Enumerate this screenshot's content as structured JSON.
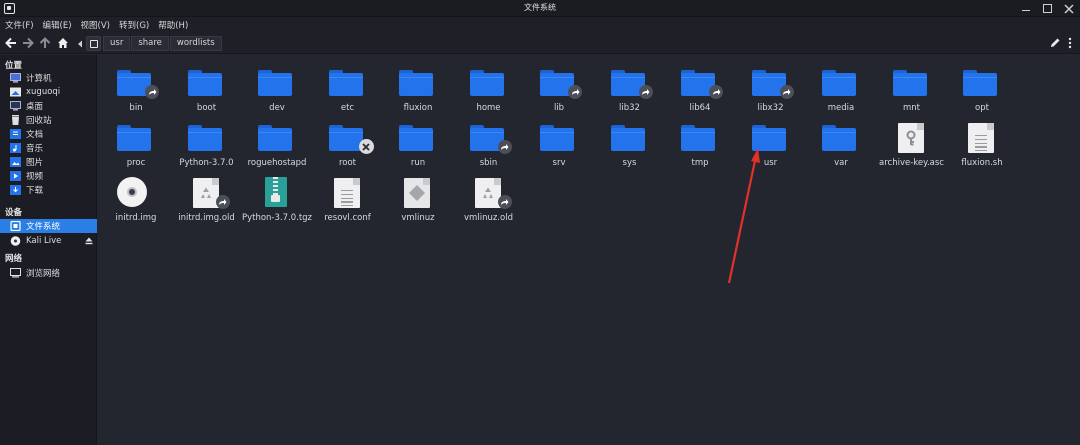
{
  "window": {
    "title": "文件系统"
  },
  "menu": [
    "文件(F)",
    "编辑(E)",
    "视图(V)",
    "转到(G)",
    "帮助(H)"
  ],
  "breadcrumbs": [
    "usr",
    "share",
    "wordlists"
  ],
  "sidebar": {
    "places_heading": "位置",
    "places": [
      {
        "label": "计算机",
        "icon": "computer-icon"
      },
      {
        "label": "xuguoqi",
        "icon": "home-folder-icon"
      },
      {
        "label": "桌面",
        "icon": "desktop-icon"
      },
      {
        "label": "回收站",
        "icon": "trash-icon"
      },
      {
        "label": "文档",
        "icon": "documents-icon"
      },
      {
        "label": "音乐",
        "icon": "music-icon"
      },
      {
        "label": "图片",
        "icon": "pictures-icon"
      },
      {
        "label": "视频",
        "icon": "videos-icon"
      },
      {
        "label": "下载",
        "icon": "downloads-icon"
      }
    ],
    "devices_heading": "设备",
    "devices": [
      {
        "label": "文件系统",
        "icon": "filesystem-icon",
        "active": true
      },
      {
        "label": "Kali Live",
        "icon": "disc-icon",
        "active": false
      }
    ],
    "network_heading": "网络",
    "network": [
      {
        "label": "浏览网络",
        "icon": "network-icon"
      }
    ]
  },
  "files": [
    {
      "name": "bin",
      "type": "folder",
      "emblem": "link"
    },
    {
      "name": "boot",
      "type": "folder",
      "emblem": ""
    },
    {
      "name": "dev",
      "type": "folder",
      "emblem": ""
    },
    {
      "name": "etc",
      "type": "folder",
      "emblem": ""
    },
    {
      "name": "fluxion",
      "type": "folder",
      "emblem": ""
    },
    {
      "name": "home",
      "type": "folder",
      "emblem": ""
    },
    {
      "name": "lib",
      "type": "folder",
      "emblem": "link"
    },
    {
      "name": "lib32",
      "type": "folder",
      "emblem": "link"
    },
    {
      "name": "lib64",
      "type": "folder",
      "emblem": "link"
    },
    {
      "name": "libx32",
      "type": "folder",
      "emblem": "link"
    },
    {
      "name": "media",
      "type": "folder",
      "emblem": ""
    },
    {
      "name": "mnt",
      "type": "folder",
      "emblem": ""
    },
    {
      "name": "opt",
      "type": "folder",
      "emblem": ""
    },
    {
      "name": "proc",
      "type": "folder",
      "emblem": ""
    },
    {
      "name": "Python-3.7.0",
      "type": "folder",
      "emblem": ""
    },
    {
      "name": "roguehostapd",
      "type": "folder",
      "emblem": ""
    },
    {
      "name": "root",
      "type": "folder",
      "emblem": "x"
    },
    {
      "name": "run",
      "type": "folder",
      "emblem": ""
    },
    {
      "name": "sbin",
      "type": "folder",
      "emblem": "link"
    },
    {
      "name": "srv",
      "type": "folder",
      "emblem": ""
    },
    {
      "name": "sys",
      "type": "folder",
      "emblem": ""
    },
    {
      "name": "tmp",
      "type": "folder",
      "emblem": ""
    },
    {
      "name": "usr",
      "type": "folder",
      "emblem": ""
    },
    {
      "name": "var",
      "type": "folder",
      "emblem": ""
    },
    {
      "name": "archive-key.asc",
      "type": "key",
      "emblem": ""
    },
    {
      "name": "fluxion.sh",
      "type": "text",
      "emblem": ""
    },
    {
      "name": "initrd.img",
      "type": "disc",
      "emblem": ""
    },
    {
      "name": "initrd.img.old",
      "type": "recycle",
      "emblem": "link"
    },
    {
      "name": "Python-3.7.0.tgz",
      "type": "archive",
      "emblem": ""
    },
    {
      "name": "resovl.conf",
      "type": "text",
      "emblem": ""
    },
    {
      "name": "vmlinuz",
      "type": "exec",
      "emblem": ""
    },
    {
      "name": "vmlinuz.old",
      "type": "recycle",
      "emblem": "link"
    }
  ],
  "colors": {
    "accent": "#2a7fe6",
    "folder": "#2374ec",
    "annotation_arrow": "#e0322b"
  }
}
